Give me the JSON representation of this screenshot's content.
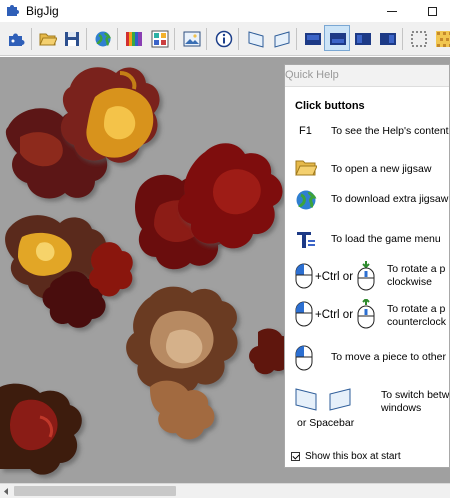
{
  "window": {
    "title": "BigJig",
    "icon": "puzzle-piece-icon"
  },
  "toolbar": {
    "buttons": [
      {
        "name": "puzzle-piece-icon",
        "pressed": false
      },
      {
        "name": "open-folder-icon",
        "pressed": false
      },
      {
        "name": "save-disk-icon",
        "pressed": false
      },
      {
        "name": "globe-icon",
        "pressed": false
      },
      {
        "name": "color-bars-icon",
        "pressed": false
      },
      {
        "name": "color-grid-icon",
        "pressed": false
      },
      {
        "name": "picture-icon",
        "pressed": false
      },
      {
        "name": "info-icon",
        "pressed": false
      },
      {
        "name": "window-left-icon",
        "pressed": false
      },
      {
        "name": "window-right-icon",
        "pressed": false
      },
      {
        "name": "tray-1-icon",
        "pressed": false
      },
      {
        "name": "tray-2-icon",
        "pressed": true
      },
      {
        "name": "tray-3-icon",
        "pressed": false
      },
      {
        "name": "tray-4-icon",
        "pressed": false
      },
      {
        "name": "dotted-select-icon",
        "pressed": false
      },
      {
        "name": "pattern-icon",
        "pressed": false
      }
    ]
  },
  "help": {
    "title": "Quick Help",
    "heading": "Click buttons",
    "f1_key": "F1",
    "f1_text": "To see the Help's content",
    "open_text": "To open a new jigsaw",
    "download_text": "To download extra jigsaw",
    "menu_text": "To load the game menu",
    "ctrl_or": "+Ctrl or",
    "rotate_cw_line1": "To rotate a p",
    "rotate_cw_line2": "clockwise",
    "rotate_ccw_line1": "To rotate a p",
    "rotate_ccw_line2": "counterclock",
    "move_text": "To move a piece to other",
    "switch_line1": "To switch betw",
    "switch_line2": "windows",
    "or_spacebar": "or Spacebar",
    "checkbox_label": "Show this box at start",
    "checkbox_checked": true
  },
  "colors": {
    "board_bg": "#a0a0a0",
    "leaf_dark": "#6e1d16",
    "leaf_red": "#9b1b12",
    "leaf_orange": "#d8931c",
    "leaf_brown": "#b78a62",
    "selected_blue": "#cce4f7"
  }
}
